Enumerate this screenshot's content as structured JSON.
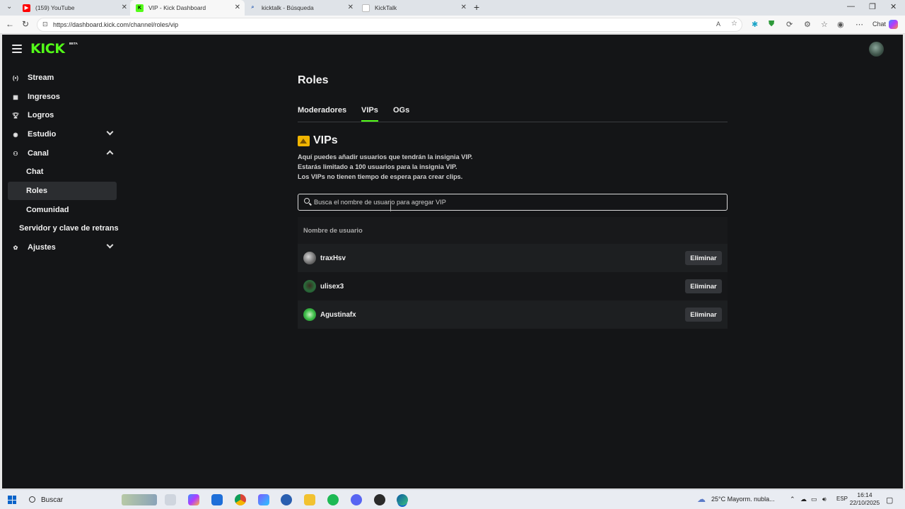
{
  "browser": {
    "tabs": [
      {
        "title": "(159) YouTube",
        "active": false
      },
      {
        "title": "VIP - Kick Dashboard",
        "active": true
      },
      {
        "title": "kicktalk - Búsqueda",
        "active": false
      },
      {
        "title": "KickTalk",
        "active": false
      }
    ],
    "url": "https://dashboard.kick.com/channel/roles/vip",
    "chat_label": "Chat"
  },
  "brand": {
    "logo": "KICK",
    "badge": "BETA",
    "accent": "#53fc18"
  },
  "sidebar": {
    "items": [
      {
        "label": "Stream",
        "icon": "broadcast-icon"
      },
      {
        "label": "Ingresos",
        "icon": "chart-icon"
      },
      {
        "label": "Logros",
        "icon": "trophy-icon"
      },
      {
        "label": "Estudio",
        "icon": "studio-icon"
      },
      {
        "label": "Canal",
        "icon": "channel-icon"
      },
      {
        "label": "Chat"
      },
      {
        "label": "Roles"
      },
      {
        "label": "Comunidad"
      },
      {
        "label": "Servidor y clave de retrans"
      },
      {
        "label": "Ajustes",
        "icon": "gear-icon"
      }
    ]
  },
  "main": {
    "title": "Roles",
    "tabs": [
      {
        "label": "Moderadores"
      },
      {
        "label": "VIPs",
        "selected": true
      },
      {
        "label": "OGs"
      }
    ],
    "section_title": "VIPs",
    "description": [
      "Aquí puedes añadir usuarios que tendrán la insignia VIP.",
      "Estarás limitado a 100 usuarios para la insignia VIP.",
      "Los VIPs no tienen tiempo de espera para crear clips."
    ],
    "search_placeholder": "Busca el nombre de usuario para agregar VIP",
    "table": {
      "column": "Nombre de usuario",
      "rows": [
        {
          "username": "traxHsv",
          "action": "Eliminar"
        },
        {
          "username": "ulisex3",
          "action": "Eliminar"
        },
        {
          "username": "Agustinafx",
          "action": "Eliminar"
        }
      ]
    }
  },
  "taskbar": {
    "search_label": "Buscar",
    "weather": "25°C  Mayorm. nubla...",
    "language": "ESP",
    "time": "16:14",
    "date": "22/10/2025"
  }
}
